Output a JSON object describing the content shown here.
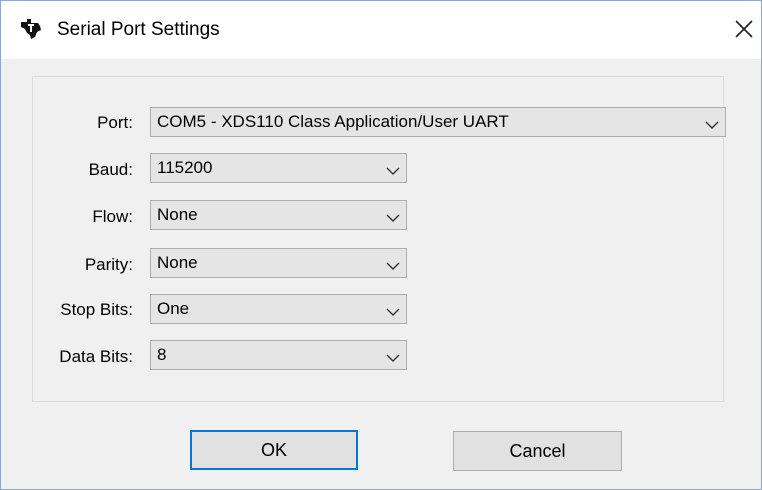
{
  "window": {
    "title": "Serial Port Settings",
    "accent_color": "#0078d7",
    "icons": {
      "app": "ti-logo-icon",
      "close": "close-icon"
    }
  },
  "fields": [
    {
      "key": "port",
      "label": "Port:",
      "value": "COM5 - XDS110 Class Application/User UART"
    },
    {
      "key": "baud",
      "label": "Baud:",
      "value": "115200"
    },
    {
      "key": "flow",
      "label": "Flow:",
      "value": "None"
    },
    {
      "key": "parity",
      "label": "Parity:",
      "value": "None"
    },
    {
      "key": "stop_bits",
      "label": "Stop Bits:",
      "value": "One"
    },
    {
      "key": "data_bits",
      "label": "Data Bits:",
      "value": "8"
    }
  ],
  "buttons": {
    "ok": "OK",
    "cancel": "Cancel"
  }
}
